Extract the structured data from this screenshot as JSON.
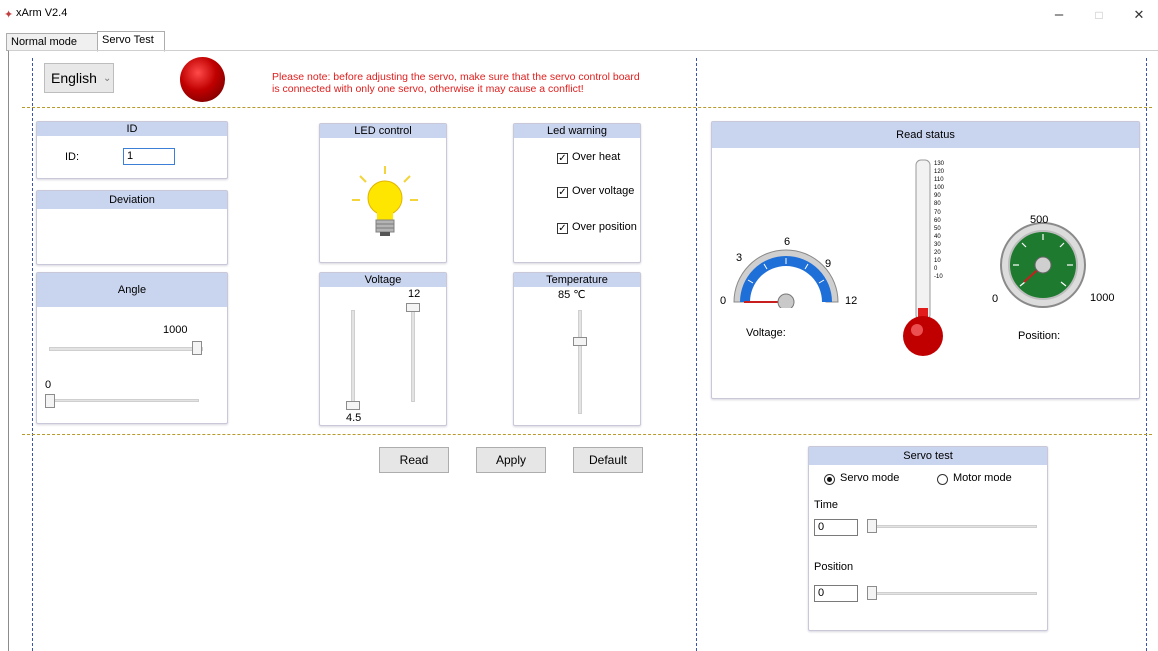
{
  "window": {
    "title": "xArm V2.4",
    "minimize": "–",
    "maximize": "□",
    "close": "✕"
  },
  "tabs": [
    {
      "label": "Normal mode"
    },
    {
      "label": "Servo Test"
    }
  ],
  "language": {
    "selected": "English",
    "arrow": "⌄"
  },
  "note": {
    "line1": "Please note: before adjusting the servo, make sure that the servo control board",
    "line2": "is connected with only one servo, otherwise it may cause a conflict!",
    "color": "#e0201f"
  },
  "id_panel": {
    "title": "ID",
    "label": "ID:",
    "value": "1"
  },
  "deviation_panel": {
    "title": "Deviation"
  },
  "angle_panel": {
    "title": "Angle",
    "max_label": "1000",
    "min_label": "0",
    "slider1_level": 1.0,
    "slider2_level": 0.0
  },
  "led_panel": {
    "title": "LED control",
    "icon": "lightbulb-icon"
  },
  "led_warning": {
    "title": "Led warning",
    "items": [
      {
        "label": "Over heat",
        "checked": true
      },
      {
        "label": "Over voltage",
        "checked": true
      },
      {
        "label": "Over position",
        "checked": true
      }
    ]
  },
  "voltage_panel": {
    "title": "Voltage",
    "max_label": "12",
    "min_label": "4.5"
  },
  "temperature_panel": {
    "title": "Temperature",
    "value": "85 ℃"
  },
  "read_status": {
    "title": "Read status",
    "voltage_gauge": {
      "labels": [
        "0",
        "3",
        "6",
        "9",
        "12"
      ],
      "caption": "Voltage:",
      "value": 0
    },
    "thermometer": {
      "ticks": [
        "130",
        "120",
        "110",
        "100",
        "90",
        "80",
        "70",
        "60",
        "50",
        "40",
        "30",
        "20",
        "10",
        "0",
        "-10"
      ],
      "value": -10
    },
    "position_gauge": {
      "labels": [
        "0",
        "500",
        "1000"
      ],
      "caption": "Position:"
    }
  },
  "buttons": {
    "read": "Read",
    "apply": "Apply",
    "default": "Default"
  },
  "servo_test": {
    "title": "Servo test",
    "servo_mode": "Servo mode",
    "motor_mode": "Motor mode",
    "selected_mode": "servo",
    "time_label": "Time",
    "time_value": "0",
    "position_label": "Position",
    "position_value": "0"
  },
  "colors": {
    "accent_header": "#c9d4ef",
    "status_led": "#b00000",
    "gauge_blue": "#1f6fd8",
    "gauge_green": "#1d7a2e"
  }
}
